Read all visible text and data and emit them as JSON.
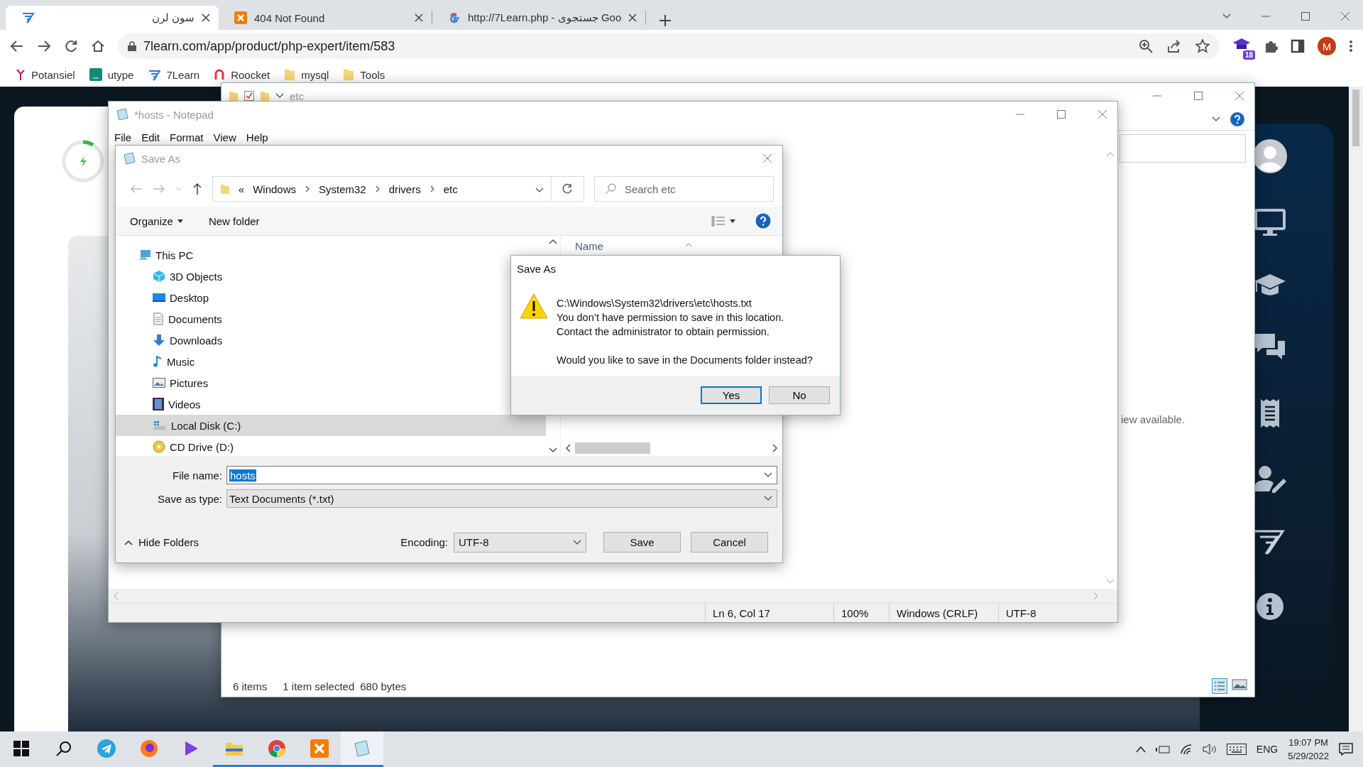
{
  "browser": {
    "tabs": [
      {
        "title": "سون لرن",
        "kind": "sevenlearn",
        "selected": true
      },
      {
        "title": "404 Not Found",
        "kind": "xampp",
        "selected": false
      },
      {
        "title": "http://7Learn.php - جستجوی Goo",
        "kind": "google",
        "selected": false
      }
    ],
    "address": "7learn.com/app/product/php-expert/item/583",
    "extension_badge": "18",
    "profile_initial": "M",
    "bookmarks": [
      {
        "label": "Potansiel",
        "kind": "potansiel"
      },
      {
        "label": "utype",
        "kind": "utype"
      },
      {
        "label": "7Learn",
        "kind": "sevenlearn"
      },
      {
        "label": "Roocket",
        "kind": "roocket"
      },
      {
        "label": "mysql",
        "kind": "folder"
      },
      {
        "label": "Tools",
        "kind": "folder"
      }
    ]
  },
  "explorer_window": {
    "title": "etc",
    "preview_text": "iew available.",
    "status_items": "6 items",
    "status_selection": "1 item selected",
    "status_size": "680 bytes"
  },
  "notepad": {
    "title": "*hosts - Notepad",
    "menu": [
      "File",
      "Edit",
      "Format",
      "View",
      "Help"
    ],
    "status": [
      "Ln 6, Col 17",
      "100%",
      "Windows (CRLF)",
      "UTF-8"
    ]
  },
  "save_as": {
    "title": "Save As",
    "breadcrumb_overflow": "«",
    "breadcrumb": [
      "Windows",
      "System32",
      "drivers",
      "etc"
    ],
    "search_placeholder": "Search etc",
    "toolbar": [
      "Organize",
      "New folder"
    ],
    "navigation": [
      {
        "label": "This PC",
        "kind": "pc",
        "selected": false,
        "children": [
          {
            "label": "3D Objects",
            "kind": "cube",
            "selected": false
          },
          {
            "label": "Desktop",
            "kind": "desktop",
            "selected": false
          },
          {
            "label": "Documents",
            "kind": "documents",
            "selected": false
          },
          {
            "label": "Downloads",
            "kind": "downloads",
            "selected": false
          },
          {
            "label": "Music",
            "kind": "music",
            "selected": false
          },
          {
            "label": "Pictures",
            "kind": "pictures",
            "selected": false
          },
          {
            "label": "Videos",
            "kind": "videos",
            "selected": false
          },
          {
            "label": "Local Disk (C:)",
            "kind": "disk",
            "selected": true
          },
          {
            "label": "CD Drive (D:)",
            "kind": "cd",
            "selected": false
          }
        ]
      }
    ],
    "column": "Name",
    "file_name_label": "File name:",
    "file_name": {
      "value": "hosts",
      "selected": true
    },
    "type_label": "Save as type:",
    "type": "Text Documents (*.txt)",
    "hide_folders": "Hide Folders",
    "encoding_label": "Encoding:",
    "encoding": "UTF-8",
    "buttons": [
      "Save",
      "Cancel"
    ]
  },
  "message_box": {
    "title": "Save As",
    "lines": [
      "C:\\Windows\\System32\\drivers\\etc\\hosts.txt",
      "You don’t have permission to save in this location.",
      "Contact the administrator to obtain permission."
    ],
    "question": "Would you like to save in the Documents folder instead?",
    "buttons": [
      {
        "label": "Yes",
        "selected": true
      },
      {
        "label": "No",
        "selected": false
      }
    ]
  },
  "taskbar": {
    "apps": [
      {
        "kind": "telegram",
        "running": false,
        "selected": false
      },
      {
        "kind": "firefox",
        "running": false,
        "selected": false
      },
      {
        "kind": "video",
        "running": false,
        "selected": false
      },
      {
        "kind": "explorer",
        "running": true,
        "selected": false
      },
      {
        "kind": "chrome",
        "running": true,
        "selected": false
      },
      {
        "kind": "xampp",
        "running": true,
        "selected": false
      },
      {
        "kind": "notepad",
        "running": true,
        "selected": true
      }
    ],
    "language": "ENG",
    "time": "19:07 PM",
    "date": "5/29/2022"
  }
}
